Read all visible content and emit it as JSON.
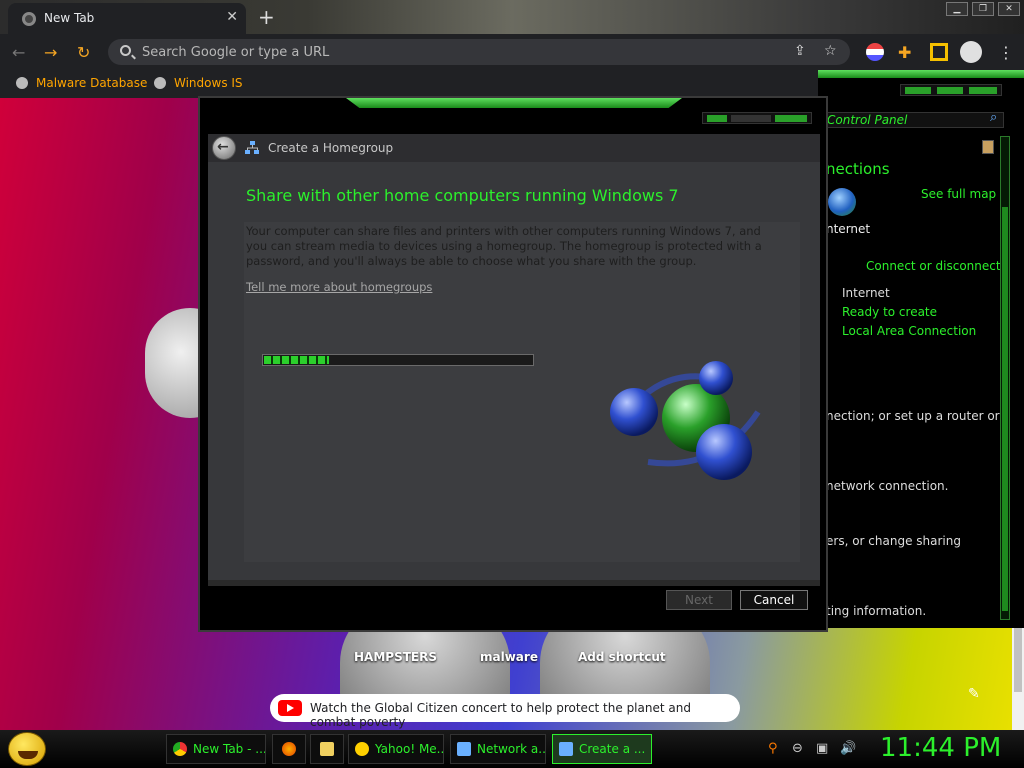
{
  "browser": {
    "tab_title": "New Tab",
    "omnibox_placeholder": "Search Google or type a URL",
    "bookmarks": [
      "Malware Database",
      "Windows IS"
    ]
  },
  "newtab": {
    "shortcuts": [
      "HAMPSTERS",
      "malware",
      "Add shortcut"
    ],
    "news_text": "Watch the Global Citizen concert to help protect the planet and combat poverty"
  },
  "control_panel": {
    "address": "Control Panel",
    "connections_title": "nections",
    "see_full_map": "See full map",
    "internet_label": "nternet",
    "connect_or_disconnect": "Connect or disconnect",
    "net_type": "Internet",
    "ready_to_create": "Ready to create",
    "local_area_connection": "Local Area Connection",
    "line1": "nection; or set up a router or",
    "line2": "network connection.",
    "line3": "ers, or change sharing",
    "line4": "ting information."
  },
  "dialog": {
    "title": "Create a Homegroup",
    "heading": "Share with other home computers running Windows 7",
    "paragraph": "Your computer can share files and printers with other computers running Windows 7, and you can stream media to devices using a homegroup. The homegroup is protected with a password, and you'll always be able to choose what you share with the group.",
    "link": "Tell me more about homegroups",
    "progress_fraction": 0.24,
    "next_label": "Next",
    "cancel_label": "Cancel"
  },
  "taskbar": {
    "items": [
      "New Tab - ...",
      "Yahoo! Me...",
      "Network a...",
      "Create a ..."
    ],
    "clock": "11:44 PM"
  }
}
